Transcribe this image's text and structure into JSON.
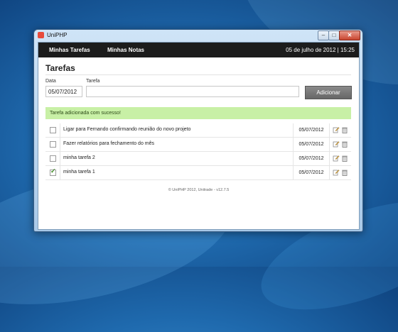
{
  "window": {
    "title": "UniPHP"
  },
  "nav": {
    "items": [
      {
        "label": "Minhas Tarefas"
      },
      {
        "label": "Minhas Notas"
      }
    ],
    "datetime": "05 de julho de 2012 | 15:25"
  },
  "page": {
    "title": "Tarefas"
  },
  "form": {
    "date_label": "Data",
    "date_value": "05/07/2012",
    "task_label": "Tarefa",
    "task_value": "",
    "add_button": "Adicionar"
  },
  "alert": {
    "message": "Tarefa adicionada com sucesso!"
  },
  "tasks": [
    {
      "text": "Ligar para Fernando confirmando reunião do novo projeto",
      "date": "05/07/2012",
      "done": false
    },
    {
      "text": "Fazer relatórios para fechamento do mês",
      "date": "05/07/2012",
      "done": false
    },
    {
      "text": "minha tarefa 2",
      "date": "05/07/2012",
      "done": false
    },
    {
      "text": "minha tarefa 1",
      "date": "05/07/2012",
      "done": true
    }
  ],
  "footer": {
    "text": "© UniPHP 2012, Unitrade - v12.7.5"
  },
  "colors": {
    "navbar": "#1c1c1c",
    "alert_bg": "#c8f0a6",
    "button": "#767676"
  },
  "icons": {
    "edit": "edit-icon",
    "delete": "trash-icon"
  }
}
